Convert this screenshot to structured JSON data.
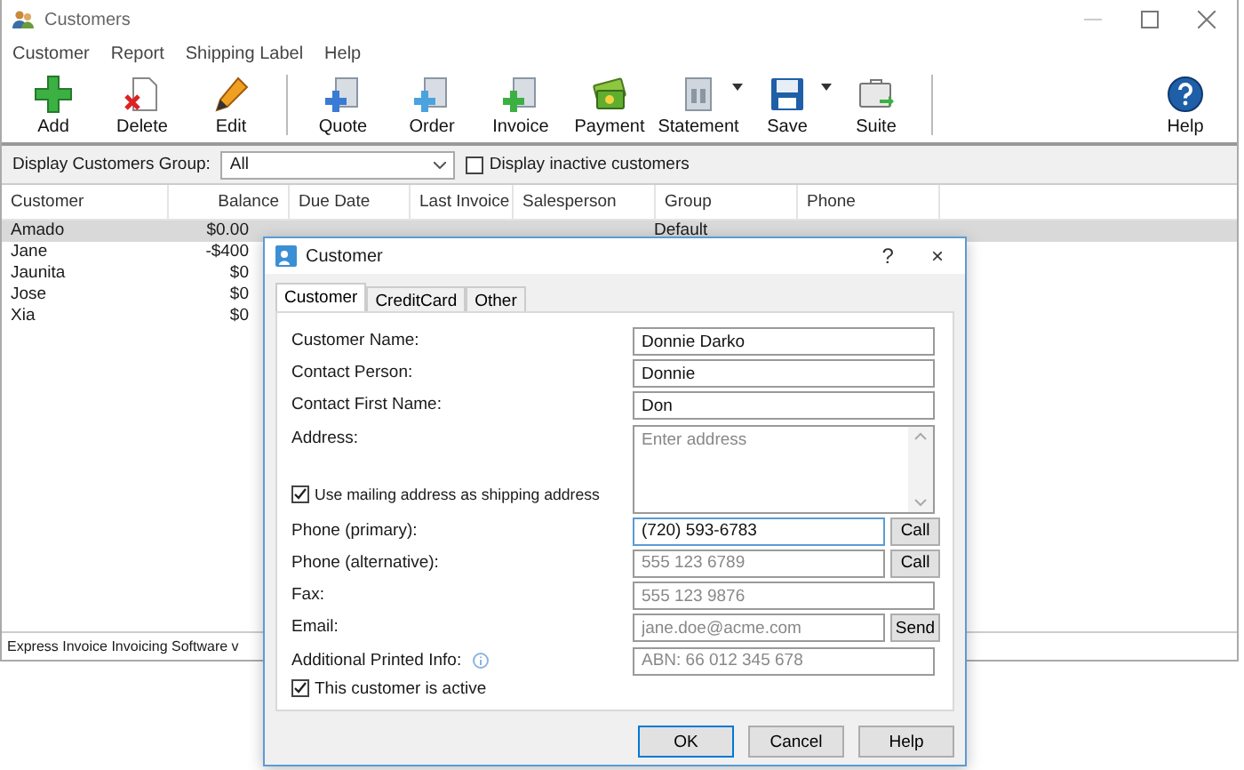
{
  "window": {
    "title": "Customers"
  },
  "menu": [
    "Customer",
    "Report",
    "Shipping Label",
    "Help"
  ],
  "toolbar_groups": [
    [
      {
        "label": "Add",
        "kind": "add",
        "dropdown": false
      },
      {
        "label": "Delete",
        "kind": "delete",
        "dropdown": false
      },
      {
        "label": "Edit",
        "kind": "edit",
        "dropdown": false
      }
    ],
    [
      {
        "label": "Quote",
        "kind": "quote",
        "dropdown": false
      },
      {
        "label": "Order",
        "kind": "order",
        "dropdown": false
      },
      {
        "label": "Invoice",
        "kind": "invoice",
        "dropdown": false
      },
      {
        "label": "Payment",
        "kind": "payment",
        "dropdown": false
      },
      {
        "label": "Statement",
        "kind": "statement",
        "dropdown": true
      },
      {
        "label": "Save",
        "kind": "save",
        "dropdown": true
      },
      {
        "label": "Suite",
        "kind": "suite",
        "dropdown": false
      }
    ]
  ],
  "toolbar_right": {
    "label": "Help",
    "kind": "help"
  },
  "filter": {
    "label": "Display Customers Group:",
    "value": "All",
    "inactive_label": "Display inactive customers",
    "inactive_checked": false
  },
  "table": {
    "columns": [
      "Customer",
      "Balance",
      "Due Date",
      "Last Invoice",
      "Salesperson",
      "Group",
      "Phone"
    ],
    "rows": [
      {
        "customer": "Amado",
        "balance": "$0.00",
        "group": "Default",
        "selected": true
      },
      {
        "customer": "Jane",
        "balance": "-$400",
        "selected": false
      },
      {
        "customer": "Jaunita",
        "balance": "$0",
        "selected": false
      },
      {
        "customer": "Jose",
        "balance": "$0",
        "selected": false
      },
      {
        "customer": "Xia",
        "balance": "$0",
        "selected": false
      }
    ]
  },
  "status_bar": "Express Invoice Invoicing Software v",
  "dialog": {
    "title": "Customer",
    "help": "?",
    "close": "×",
    "tabs": [
      {
        "label": "Customer",
        "selected": true
      },
      {
        "label": "CreditCard",
        "selected": false
      },
      {
        "label": "Other",
        "selected": false
      }
    ],
    "fields": [
      {
        "kind": "text",
        "label": "Customer Name:",
        "value": "Donnie Darko",
        "focused": false
      },
      {
        "kind": "text",
        "label": "Contact Person:",
        "value": "Donnie",
        "focused": false
      },
      {
        "kind": "text",
        "label": "Contact First Name:",
        "value": "Don",
        "focused": false
      },
      {
        "kind": "address",
        "label": "Address:",
        "placeholder": "Enter address",
        "checkbox": {
          "label": "Use mailing address as shipping address",
          "checked": true
        }
      },
      {
        "kind": "text",
        "label": "Phone (primary):",
        "value": "(720) 593-6783",
        "button": "Call",
        "focused": true
      },
      {
        "kind": "text",
        "label": "Phone (alternative):",
        "placeholder": "555 123 6789",
        "button": "Call",
        "focused": false
      },
      {
        "kind": "text",
        "label": "Fax:",
        "placeholder": "555 123 9876",
        "focused": false
      },
      {
        "kind": "text",
        "label": "Email:",
        "placeholder": "jane.doe@acme.com",
        "button": "Send",
        "focused": false
      },
      {
        "kind": "text",
        "label": "Additional Printed Info:",
        "placeholder": "ABN: 66 012 345 678",
        "info": true,
        "focused": false
      },
      {
        "kind": "checkbox",
        "label": "This customer is active",
        "checked": true
      }
    ],
    "buttons": [
      {
        "label": "OK",
        "default": true
      },
      {
        "label": "Cancel",
        "default": false
      },
      {
        "label": "Help",
        "default": false
      }
    ]
  }
}
